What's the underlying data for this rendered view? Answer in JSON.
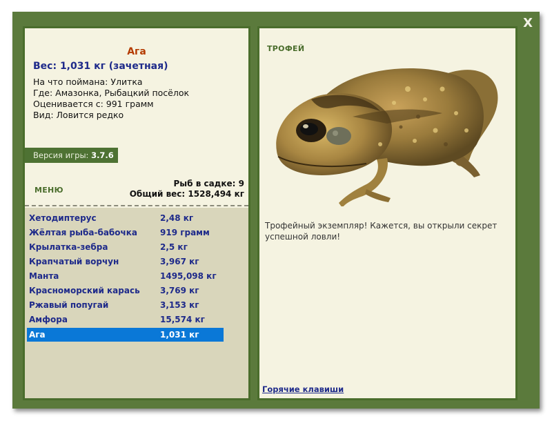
{
  "window": {
    "close_label": "X"
  },
  "fish": {
    "name": "Ага",
    "weight_line": "Вес: 1,031 кг (зачетная)",
    "bait_line": "На что поймана: Улитка",
    "location_line": "Где: Амазонка, Рыбацкий посёлок",
    "valued_line": "Оценивается с: 991 грамм",
    "rarity_line": "Вид: Ловится редко"
  },
  "version": {
    "label": "Версия игры: ",
    "value": "3.7.6"
  },
  "menu": {
    "label": "МЕНЮ"
  },
  "stats": {
    "count_line": "Рыб в садке: 9",
    "total_line": "Общий вес: 1528,494 кг"
  },
  "catches": [
    {
      "name": "Хетодиптерус",
      "weight": "2,48 кг"
    },
    {
      "name": "Жёлтая рыба-бабочка",
      "weight": "919 грамм"
    },
    {
      "name": "Крылатка-зебра",
      "weight": "2,5 кг"
    },
    {
      "name": "Крапчатый ворчун",
      "weight": "3,967 кг"
    },
    {
      "name": "Манта",
      "weight": "1495,098 кг"
    },
    {
      "name": "Красноморский карась",
      "weight": "3,769 кг"
    },
    {
      "name": "Ржавый попугай",
      "weight": "3,153 кг"
    },
    {
      "name": "Амфора",
      "weight": "15,574 кг"
    },
    {
      "name": "Ага",
      "weight": "1,031 кг",
      "selected": true
    }
  ],
  "trophy": {
    "title": "ТРОФЕЙ",
    "description": "Трофейный экземпляр! Кажется, вы открыли секрет успешной ловли!",
    "hotkeys_label": "Горячие клавиши",
    "image_icon": "cane-toad-image"
  },
  "colors": {
    "frame": "#5b7a3c",
    "panel": "#f5f3e1",
    "list_bg": "#d9d6bb",
    "selection": "#0a78d7",
    "fish_name": "#b43b00",
    "link_blue": "#1e2a8a"
  }
}
